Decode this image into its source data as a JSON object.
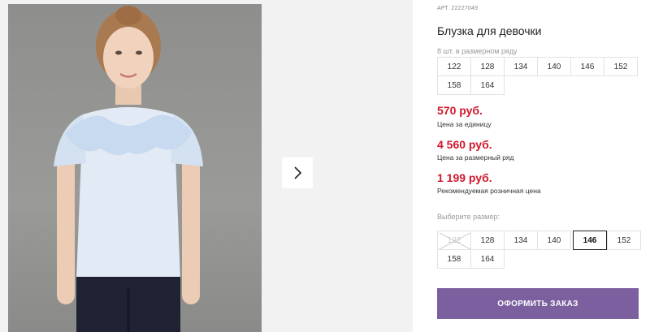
{
  "product": {
    "article": "АРТ. 22227049",
    "title": "Блузка для девочки"
  },
  "size_row": {
    "caption": "8 шт. в размерном ряду",
    "sizes": [
      "122",
      "128",
      "134",
      "140",
      "146",
      "152",
      "158",
      "164"
    ]
  },
  "prices": [
    {
      "value": "570 руб.",
      "label": "Цена за единицу"
    },
    {
      "value": "4 560 руб.",
      "label": "Цена за размерный ряд"
    },
    {
      "value": "1 199 руб.",
      "label": "Рекомендуемая розничная цена"
    }
  ],
  "size_picker": {
    "caption": "Выберите размер:",
    "sizes": [
      "122",
      "128",
      "134",
      "140",
      "146",
      "152",
      "158",
      "164"
    ],
    "selected": "146",
    "unavailable": [
      "122"
    ]
  },
  "order_button": {
    "label": "ОФОРМИТЬ ЗАКАЗ"
  },
  "colors": {
    "price": "#d0192d",
    "order_button": "#7b5f9f",
    "gallery_background": "#f2f2f2"
  },
  "icons": {
    "next": "chevron-right-icon",
    "unavailable": "cross-out-icon"
  }
}
